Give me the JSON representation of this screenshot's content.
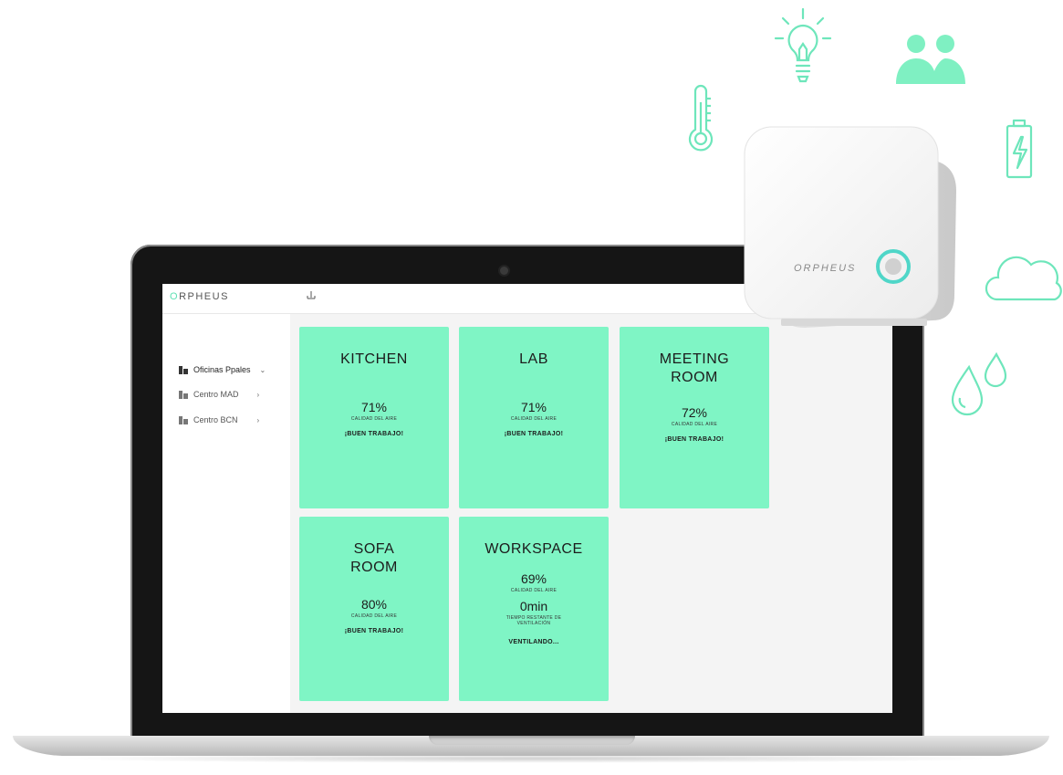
{
  "brand": {
    "logo_prefix": "O",
    "logo_rest": "RPHEUS",
    "device_label": "ORPHEUS",
    "accent": "#5fe0b3",
    "card_color": "#7ff5c5"
  },
  "topbar": {
    "icon": "download-icon",
    "icon_glyph": "⫫"
  },
  "sidebar": {
    "items": [
      {
        "label": "Oficinas Ppales",
        "chevron": "⌄",
        "icon": "building-icon"
      },
      {
        "label": "Centro MAD",
        "chevron": "›",
        "icon": "building-icon"
      },
      {
        "label": "Centro BCN",
        "chevron": "›",
        "icon": "building-icon"
      }
    ]
  },
  "rooms": [
    {
      "name": "KITCHEN",
      "value": "71%",
      "value_label": "CALIDAD DEL AIRE",
      "status": "¡BUEN TRABAJO!"
    },
    {
      "name": "LAB",
      "value": "71%",
      "value_label": "CALIDAD DEL AIRE",
      "status": "¡BUEN TRABAJO!"
    },
    {
      "name_line1": "MEETING",
      "name_line2": "ROOM",
      "value": "72%",
      "value_label": "CALIDAD DEL AIRE",
      "status": "¡BUEN TRABAJO!"
    },
    {
      "name_line1": "SOFA",
      "name_line2": "ROOM",
      "value": "80%",
      "value_label": "CALIDAD DEL AIRE",
      "status": "¡BUEN TRABAJO!"
    },
    {
      "name": "WORKSPACE",
      "value": "69%",
      "value_label": "CALIDAD DEL AIRE",
      "value2": "0min",
      "value2_label_line1": "TIEMPO RESTANTE DE",
      "value2_label_line2": "VENTILACIÓN",
      "status": "VENTILANDO..."
    }
  ],
  "floating_icons": [
    "thermometer-icon",
    "lightbulb-icon",
    "people-icon",
    "battery-icon",
    "cloud-icon",
    "water-drops-icon"
  ]
}
